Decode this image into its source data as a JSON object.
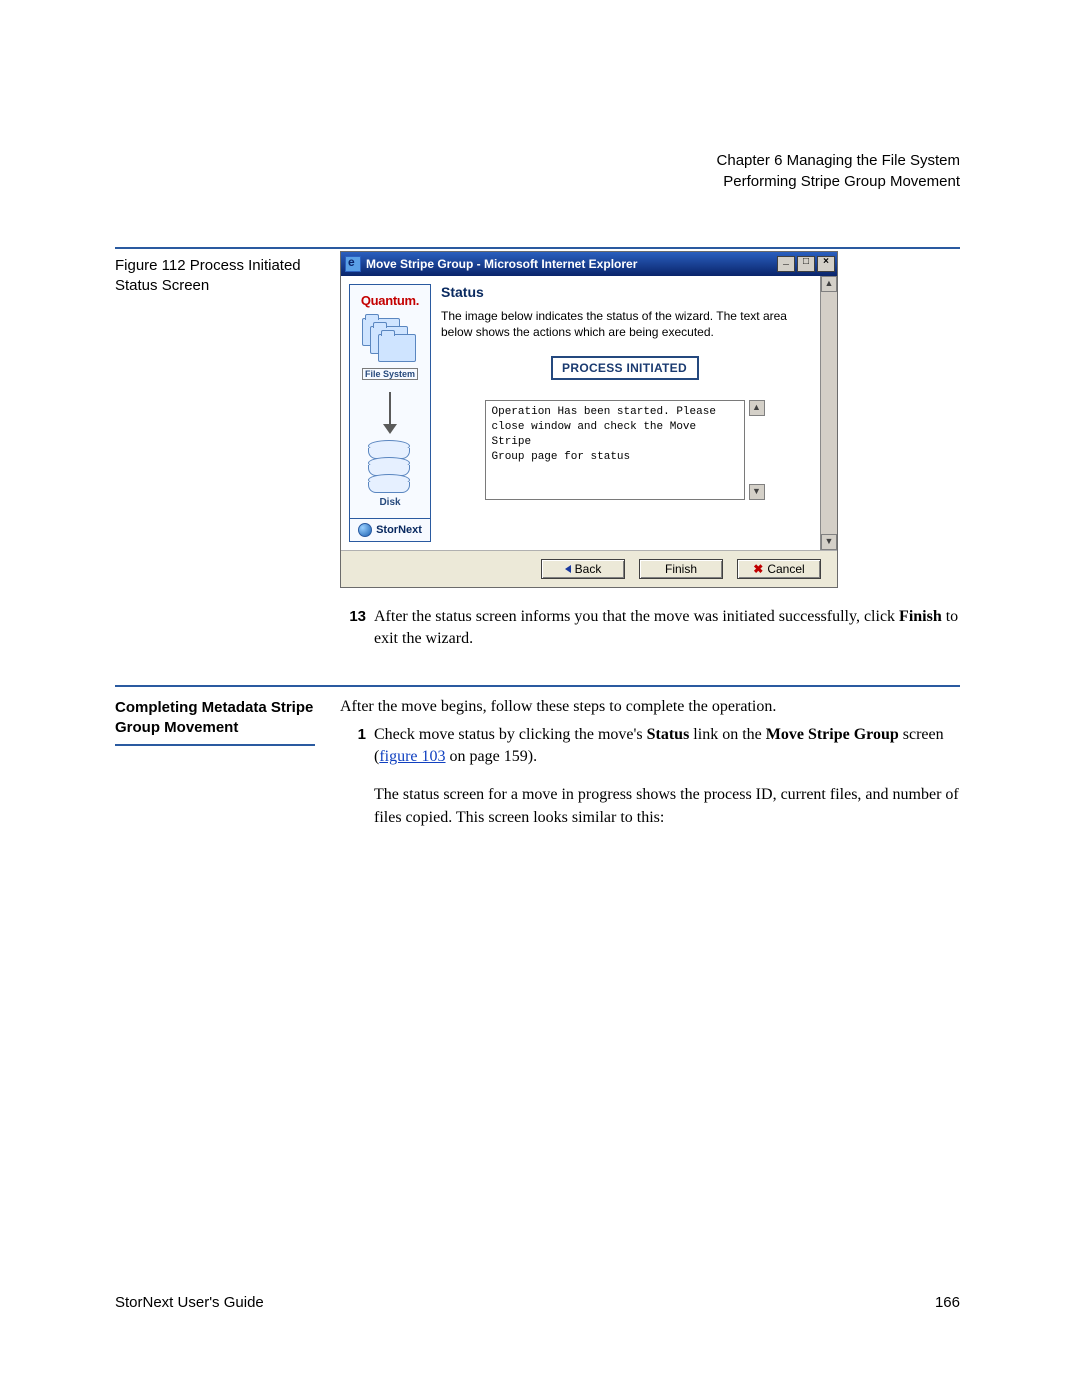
{
  "header": {
    "chapter": "Chapter 6  Managing the File System",
    "section": "Performing Stripe Group Movement"
  },
  "figure": {
    "caption": "Figure 112  Process Initiated Status Screen"
  },
  "window": {
    "title": "Move Stripe Group - Microsoft Internet Explorer",
    "min": "_",
    "max": "□",
    "close": "×"
  },
  "sidebar": {
    "brand": "Quantum.",
    "fs_label": "File System",
    "disk_label": "Disk",
    "product": "StorNext"
  },
  "wizard": {
    "title": "Status",
    "description": "The image below indicates the status of the wizard. The text area below shows the actions which are being executed.",
    "badge": "PROCESS INITIATED",
    "message": "Operation Has been started. Please\nclose window and check the Move Stripe\nGroup page for status"
  },
  "buttons": {
    "back": "Back",
    "finish": "Finish",
    "cancel": "Cancel"
  },
  "step13": {
    "num": "13",
    "text_a": "After the status screen informs you that the move was initiated successfully, click ",
    "bold": "Finish",
    "text_b": " to exit the wizard."
  },
  "section2": {
    "title": "Completing Metadata Stripe Group Movement",
    "intro": "After the move begins, follow these steps to complete the operation.",
    "step1_num": "1",
    "step1_a": "Check move status by clicking the move's ",
    "step1_b1": "Status",
    "step1_c": " link on the ",
    "step1_b2": "Move Stripe Group",
    "step1_d": " screen (",
    "step1_link": "figure 103",
    "step1_e": " on page 159).",
    "para2": "The status screen for a move in progress shows the process ID, current files, and number of files copied. This screen looks similar to this:"
  },
  "footer": {
    "left": "StorNext User's Guide",
    "right": "166"
  }
}
